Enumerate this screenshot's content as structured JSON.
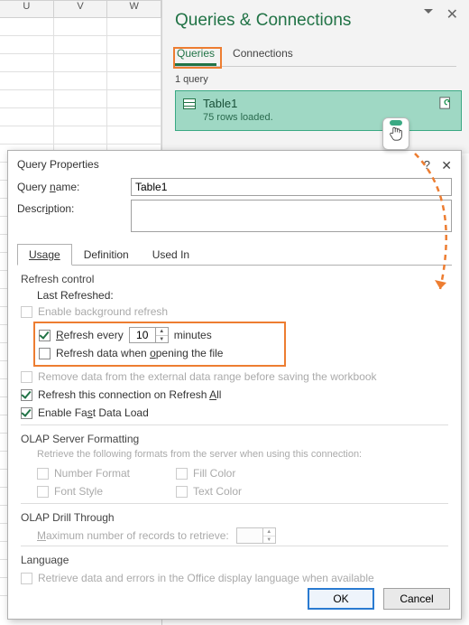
{
  "sheet": {
    "cols": [
      "U",
      "V",
      "W"
    ]
  },
  "pane": {
    "title": "Queries & Connections",
    "tab_queries": "Queries",
    "tab_connections": "Connections",
    "count": "1 query",
    "item_name": "Table1",
    "item_status": "75 rows loaded."
  },
  "dialog": {
    "title": "Query Properties",
    "help": "?",
    "close": "✕",
    "name_label": "Query name:",
    "name_value": "Table1",
    "desc_label": "Description:",
    "desc_value": "",
    "tabs": {
      "usage": "Usage",
      "definition": "Definition",
      "usedin": "Used In"
    },
    "refresh_section": "Refresh control",
    "last_refreshed_label": "Last Refreshed:",
    "cb_bg": "Enable background refresh",
    "cb_every_pre": "Refresh every",
    "every_value": "10",
    "cb_every_post": "minutes",
    "cb_open": "Refresh data when opening the file",
    "cb_remove": "Remove data from the external data range before saving the workbook",
    "cb_all": "Refresh this connection on Refresh All",
    "cb_fast": "Enable Fast Data Load",
    "olap_section": "OLAP Server Formatting",
    "olap_hint": "Retrieve the following formats from the server when using this connection:",
    "olap_numfmt": "Number Format",
    "olap_fill": "Fill Color",
    "olap_font": "Font Style",
    "olap_text": "Text Color",
    "drill_section": "OLAP Drill Through",
    "drill_label": "Maximum number of records to retrieve:",
    "drill_value": "",
    "lang_section": "Language",
    "lang_cb": "Retrieve data and errors in the Office display language when available",
    "ok": "OK",
    "cancel": "Cancel"
  }
}
